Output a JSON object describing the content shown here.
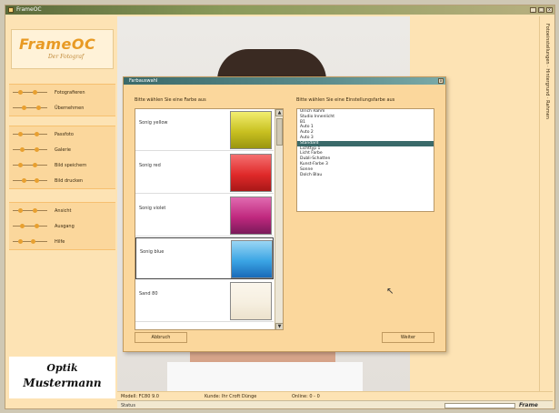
{
  "window": {
    "title": "FrameOC",
    "buttons": [
      "_",
      "□",
      "x"
    ]
  },
  "sidebar": {
    "logo": {
      "main": "FrameOC",
      "sub": "Der Fotograf"
    },
    "groups": [
      {
        "items": [
          {
            "label": "Fotografieren"
          },
          {
            "label": "Übernehmen"
          }
        ]
      },
      {
        "items": [
          {
            "label": "Passfoto"
          },
          {
            "label": "Galerie"
          },
          {
            "label": "Bild speichern"
          },
          {
            "label": "Bild drucken"
          }
        ]
      },
      {
        "items": [
          {
            "label": "Ansicht"
          },
          {
            "label": "Ausgang"
          },
          {
            "label": "Hilfe"
          }
        ]
      }
    ],
    "optik": {
      "line1": "Optik",
      "line2": "Mustermann"
    }
  },
  "right_panel": {
    "vertical_text": "Fotoeinstellungen · Hintergrund · Rahmen"
  },
  "infobar": {
    "model": "Modell: FC80 9.0",
    "frame": "Kunde: Ihr Croft Dünge",
    "online": "Online: 0 - 0"
  },
  "statusbar": {
    "label": "Status",
    "brand": "Frame"
  },
  "dialog": {
    "title": "Farbauswahl",
    "color_prompt": "Bitte wählen Sie eine Farbe aus",
    "env_prompt": "Bitte wählen Sie eine Einstellungsfarbe aus",
    "colors": [
      {
        "name": "Sonig yellow",
        "swatch": [
          "#f2ee70",
          "#c8c020",
          "#9a9610"
        ]
      },
      {
        "name": "Sonig red",
        "swatch": [
          "#f47070",
          "#e02a2a",
          "#a81818"
        ]
      },
      {
        "name": "Sonig violet",
        "swatch": [
          "#e06ab0",
          "#c0287e",
          "#7a1a5a"
        ]
      },
      {
        "name": "Sonig blue",
        "swatch": [
          "#9ad6f4",
          "#3aa4e4",
          "#1a6ab8"
        ]
      },
      {
        "name": "Sand 80",
        "swatch": [
          "#fbf6ec",
          "#f6efe0",
          "#ece2cc"
        ]
      }
    ],
    "environment_items": [
      "Ulrich Rahm",
      "Studio Innenlicht",
      "B1",
      "Auto 1",
      "Auto 2",
      "Auto 3",
      "Standard",
      "Lichttyp 1",
      "Licht Farbe",
      "Dubli-Schatten",
      "Kunst-Farbe 3",
      "Sonne",
      "Dolch Blau"
    ],
    "selected_env_index": 6,
    "buttons": {
      "left": "Abbruch",
      "right": "Weiter"
    }
  },
  "colors": {
    "app_bg": "#fde3b4",
    "accent_teal": "#3a6a6a",
    "accent_orange": "#e89a24"
  }
}
